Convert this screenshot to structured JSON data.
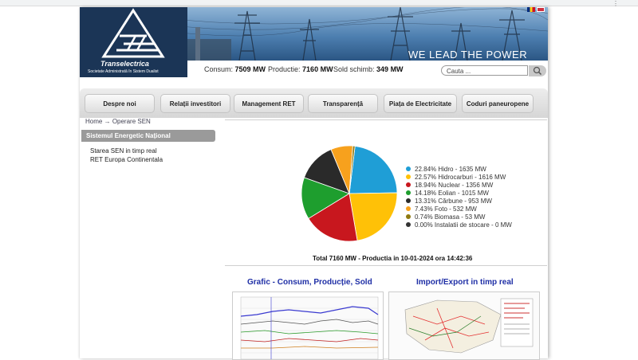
{
  "header": {
    "logo_name": "Transelectrica",
    "logo_sub": "Societate Administrată în Sistem Dualist",
    "slogan": "WE LEAD THE POWER",
    "flags": [
      "romanian-flag",
      "uk-flag"
    ]
  },
  "stats": {
    "consum_label": "Consum:",
    "consum_value": "7509 MW",
    "productie_label": "Productie:",
    "productie_value": "7160 MW",
    "sold_label": "Sold schimb:",
    "sold_value": "349 MW"
  },
  "search": {
    "placeholder": "Cauta ..."
  },
  "nav": {
    "items": [
      {
        "label": "Despre noi"
      },
      {
        "label": "Relații investitori"
      },
      {
        "label": "Management RET"
      },
      {
        "label": "Transparență"
      },
      {
        "label": "Piața de Electricitate"
      },
      {
        "label": "Coduri paneuropene"
      }
    ]
  },
  "breadcrumb": {
    "home": "Home",
    "arrow": "→",
    "current": "Operare SEN"
  },
  "sidebar": {
    "heading": "Sistemul Energetic Național",
    "links": [
      {
        "label": "Starea SEN in timp real"
      },
      {
        "label": "RET Europa Continentala"
      }
    ]
  },
  "chart_data": {
    "type": "pie",
    "slices": [
      {
        "label": "22.84% Hidro - 1635 MW",
        "name": "Hidro",
        "value": 1635,
        "percent": 22.84,
        "color": "#1f9ed6"
      },
      {
        "label": "22.57% Hidrocarburi - 1616 MW",
        "name": "Hidrocarburi",
        "value": 1616,
        "percent": 22.57,
        "color": "#ffc107"
      },
      {
        "label": "18.94% Nuclear - 1356 MW",
        "name": "Nuclear",
        "value": 1356,
        "percent": 18.94,
        "color": "#c8171e"
      },
      {
        "label": "14.18% Eolian - 1015 MW",
        "name": "Eolian",
        "value": 1015,
        "percent": 14.18,
        "color": "#1e9e2e"
      },
      {
        "label": "13.31% Cărbune - 953 MW",
        "name": "Cărbune",
        "value": 953,
        "percent": 13.31,
        "color": "#2a2a2a"
      },
      {
        "label": "7.43% Foto - 532 MW",
        "name": "Foto",
        "value": 532,
        "percent": 7.43,
        "color": "#f7a11d"
      },
      {
        "label": "0.74% Biomasa - 53 MW",
        "name": "Biomasa",
        "value": 53,
        "percent": 0.74,
        "color": "#8f7a10"
      },
      {
        "label": "0.00% Instalatii de stocare - 0 MW",
        "name": "Instalatii de stocare",
        "value": 0,
        "percent": 0.0,
        "color": "#333333"
      }
    ],
    "total_label": "Total 7160 MW - Productia in 10-01-2024 ora 14:42:36"
  },
  "sections": {
    "grafic_title": "Grafic - Consum, Producție, Sold",
    "import_title": "Import/Export in timp real"
  }
}
